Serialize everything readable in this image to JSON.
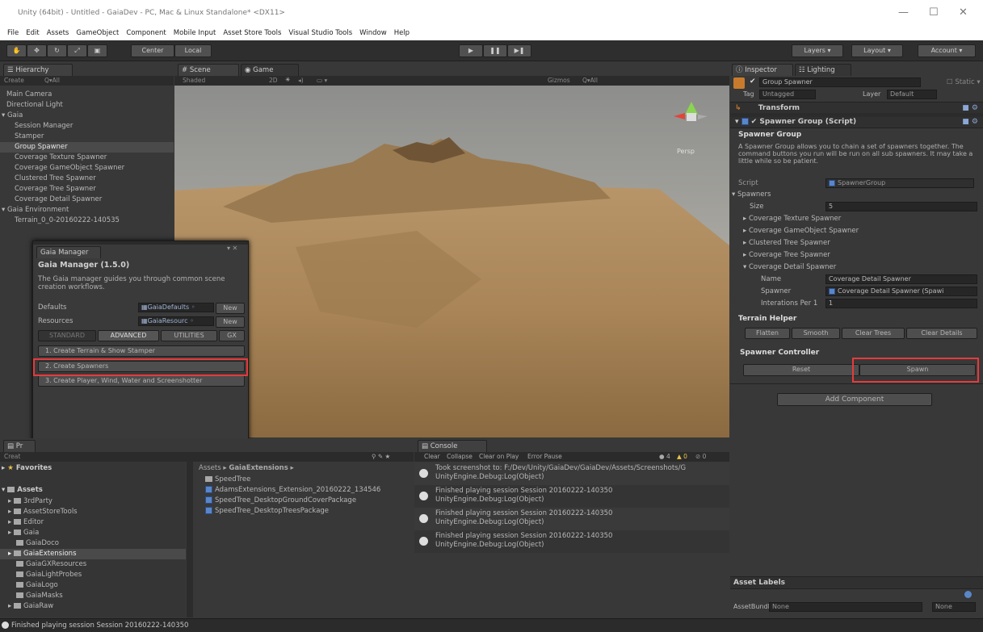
{
  "window": {
    "title": "Unity (64bit) - Untitled - GaiaDev - PC, Mac & Linux Standalone* <DX11>"
  },
  "menu": [
    "File",
    "Edit",
    "Assets",
    "GameObject",
    "Component",
    "Mobile Input",
    "Asset Store Tools",
    "Visual Studio Tools",
    "Window",
    "Help"
  ],
  "toolbar": {
    "center": "Center",
    "local": "Local",
    "layers": "Layers",
    "layout": "Layout",
    "account": "Account"
  },
  "hierarchy": {
    "tab": "Hierarchy",
    "create": "Create",
    "search": "Q▾All",
    "items": [
      "Main Camera",
      "Directional Light",
      "Gaia",
      "Session Manager",
      "Stamper",
      "Group Spawner",
      "Texture Spawner",
      "Coverage GameObject Spawner",
      "Clustered Tree Spawner",
      "Coverage Tree Spawner",
      "Coverage Detail Spawner",
      "Gaia Environment",
      "Terrain_0_0-20160222-140535"
    ],
    "texture_spawner_full": "Coverage Texture Spawner"
  },
  "scene": {
    "tab_scene": "Scene",
    "tab_game": "Game",
    "shaded": "Shaded",
    "mode2d": "2D",
    "gizmos": "Gizmos",
    "search": "Q▾All",
    "persp": "Persp"
  },
  "gaia_manager": {
    "title": "Gaia Manager",
    "heading": "Gaia Manager (1.5.0)",
    "desc": "The Gaia manager guides you through common scene creation workflows.",
    "defaults_label": "Defaults",
    "defaults_value": "GaiaDefaults",
    "resources_label": "Resources",
    "resources_value": "GaiaResourc",
    "new": "New",
    "tabs": [
      "STANDARD",
      "ADVANCED",
      "UTILITIES",
      "GX"
    ],
    "steps": [
      "1. Create Terrain & Show Stamper",
      "2. Create Spawners",
      "3. Create Player, Wind, Water and Screenshotter"
    ]
  },
  "inspector": {
    "tab": "Inspector",
    "tab2": "Lighting",
    "object_name": "Group Spawner",
    "static": "Static",
    "tag_label": "Tag",
    "tag_value": "Untagged",
    "layer_label": "Layer",
    "layer_value": "Default",
    "transform": "Transform",
    "component": "Spawner Group (Script)",
    "group_title": "Spawner Group",
    "group_desc": "A Spawner Group allows you to chain a set of spawners together. The command buttons you run will be run on all sub spawners. It may take a little while so be patient.",
    "script_label": "Script",
    "script_value": "SpawnerGroup",
    "spawners_label": "Spawners",
    "size_label": "Size",
    "size_value": "5",
    "spawner_items": [
      "Coverage Texture Spawner",
      "Coverage GameObject Spawner",
      "Clustered Tree Spawner",
      "Coverage Tree Spawner",
      "Coverage Detail Spawner"
    ],
    "name_label": "Name",
    "name_value": "Coverage Detail Spawner",
    "spawner_label": "Spawner",
    "spawner_value": "Coverage Detail Spawner (Spawi",
    "iter_label": "Interations Per 1",
    "iter_value": "1",
    "terrain_helper": "Terrain Helper",
    "helper_buttons": [
      "Flatten",
      "Smooth",
      "Clear Trees",
      "Clear Details"
    ],
    "controller": "Spawner Controller",
    "reset": "Reset",
    "spawn": "Spawn",
    "add_component": "Add Component",
    "asset_labels": "Asset Labels",
    "asset_bundle": "AssetBundle",
    "none": "None"
  },
  "project": {
    "tab": "Pr",
    "create": "Creat",
    "favorites": "Favorites",
    "assets": "Assets",
    "tree": [
      "3rdParty",
      "AssetStoreTools",
      "Editor",
      "Gaia",
      "GaiaDoco",
      "GaiaExtensions",
      "GaiaGXResources",
      "GaiaLightProbes",
      "GaiaLogo",
      "GaiaMasks",
      "GaiaRaw"
    ],
    "breadcrumb_root": "Assets",
    "breadcrumb_folder": "GaiaExtensions",
    "files": [
      "SpeedTree",
      "AdamsExtensions_Extension_20160222_134546",
      "SpeedTree_DesktopGroundCoverPackage",
      "SpeedTree_DesktopTreesPackage"
    ]
  },
  "console": {
    "tab": "Console",
    "buttons": [
      "Clear",
      "Collapse",
      "Clear on Play",
      "Error Pause"
    ],
    "counts": [
      "4",
      "0",
      "0"
    ],
    "entries": [
      {
        "line1": "Took screenshot to: F:/Dev/Unity/GaiaDev/GaiaDev/Assets/Screenshots/G",
        "line2": "UnityEngine.Debug:Log(Object)"
      },
      {
        "line1": "Finished playing session Session 20160222-140350",
        "line2": "UnityEngine.Debug:Log(Object)"
      },
      {
        "line1": "Finished playing session Session 20160222-140350",
        "line2": "UnityEngine.Debug:Log(Object)"
      },
      {
        "line1": "Finished playing session Session 20160222-140350",
        "line2": "UnityEngine.Debug:Log(Object)"
      }
    ]
  },
  "status": "Finished playing session Session 20160222-140350"
}
